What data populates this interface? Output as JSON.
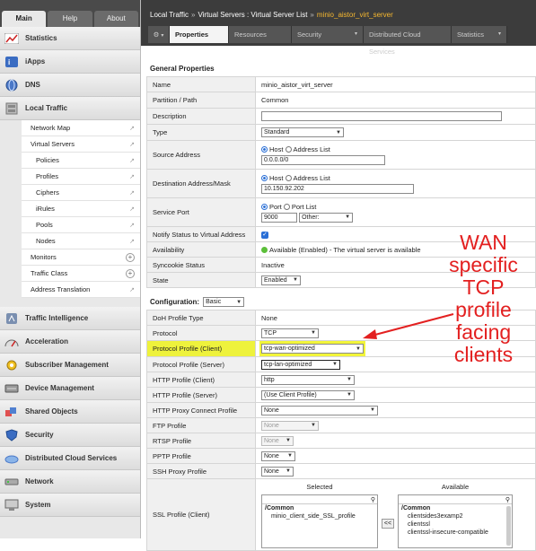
{
  "nav": {
    "tabs": [
      "Main",
      "Help",
      "About"
    ],
    "sections": [
      {
        "label": "Statistics",
        "icon": "statistics-icon"
      },
      {
        "label": "iApps",
        "icon": "iapps-icon"
      },
      {
        "label": "DNS",
        "icon": "dns-icon"
      },
      {
        "label": "Local Traffic",
        "icon": "local-traffic-icon"
      }
    ],
    "local_traffic_items": [
      {
        "label": "Network Map",
        "indent": false,
        "suffix": "arrow"
      },
      {
        "label": "Virtual Servers",
        "indent": false,
        "suffix": "arrow"
      },
      {
        "label": "Policies",
        "indent": true,
        "suffix": "arrow"
      },
      {
        "label": "Profiles",
        "indent": true,
        "suffix": "arrow"
      },
      {
        "label": "Ciphers",
        "indent": true,
        "suffix": "arrow"
      },
      {
        "label": "iRules",
        "indent": true,
        "suffix": "arrow"
      },
      {
        "label": "Pools",
        "indent": true,
        "suffix": "arrow"
      },
      {
        "label": "Nodes",
        "indent": true,
        "suffix": "arrow"
      },
      {
        "label": "Monitors",
        "indent": false,
        "suffix": "plus"
      },
      {
        "label": "Traffic Class",
        "indent": false,
        "suffix": "plus"
      },
      {
        "label": "Address Translation",
        "indent": false,
        "suffix": "arrow"
      }
    ],
    "lower_sections": [
      {
        "label": "Traffic Intelligence",
        "icon": "traffic-intelligence-icon"
      },
      {
        "label": "Acceleration",
        "icon": "acceleration-icon"
      },
      {
        "label": "Subscriber Management",
        "icon": "subscriber-management-icon"
      },
      {
        "label": "Device Management",
        "icon": "device-management-icon"
      },
      {
        "label": "Shared Objects",
        "icon": "shared-objects-icon"
      },
      {
        "label": "Security",
        "icon": "security-icon"
      },
      {
        "label": "Distributed Cloud Services",
        "icon": "distributed-cloud-icon"
      },
      {
        "label": "Network",
        "icon": "network-icon"
      },
      {
        "label": "System",
        "icon": "system-icon"
      }
    ]
  },
  "header": {
    "breadcrumb": [
      "Local Traffic",
      "Virtual Servers : Virtual Server List",
      "minio_aistor_virt_server"
    ],
    "separators": [
      "»",
      "»"
    ],
    "tabs": [
      "Properties",
      "Resources",
      "Security",
      "Distributed Cloud Services",
      "Statistics"
    ]
  },
  "general": {
    "title": "General Properties",
    "name_label": "Name",
    "name_value": "minio_aistor_virt_server",
    "partition_label": "Partition / Path",
    "partition_value": "Common",
    "description_label": "Description",
    "type_label": "Type",
    "type_value": "Standard",
    "source_label": "Source Address",
    "source_radio1": "Host",
    "source_radio2": "Address List",
    "source_value": "0.0.0.0/0",
    "dest_label": "Destination Address/Mask",
    "dest_radio1": "Host",
    "dest_radio2": "Address List",
    "dest_value": "10.150.92.202",
    "port_label": "Service Port",
    "port_radio1": "Port",
    "port_radio2": "Port List",
    "port_value": "9000",
    "port_select": "Other:",
    "notify_label": "Notify Status to Virtual Address",
    "availability_label": "Availability",
    "availability_value": "Available (Enabled) - The virtual server is available",
    "syncookie_label": "Syncookie Status",
    "syncookie_value": "Inactive",
    "state_label": "State",
    "state_value": "Enabled"
  },
  "config": {
    "title": "Configuration:",
    "mode": "Basic",
    "doh_label": "DoH Profile Type",
    "doh_value": "None",
    "protocol_label": "Protocol",
    "protocol_value": "TCP",
    "pclient_label": "Protocol Profile (Client)",
    "pclient_value": "tcp-wan-optimized",
    "pserver_label": "Protocol Profile (Server)",
    "pserver_value": "tcp-lan-optimized",
    "httpc_label": "HTTP Profile (Client)",
    "httpc_value": "http",
    "https_label": "HTTP Profile (Server)",
    "https_value": "(Use Client Profile)",
    "proxy_label": "HTTP Proxy Connect Profile",
    "proxy_value": "None",
    "ftp_label": "FTP Profile",
    "ftp_value": "None",
    "rtsp_label": "RTSP Profile",
    "rtsp_value": "None",
    "pptp_label": "PPTP Profile",
    "pptp_value": "None",
    "ssh_label": "SSH Proxy Profile",
    "ssh_value": "None",
    "ssl_label": "SSL Profile (Client)",
    "selected_header": "Selected",
    "available_header": "Available",
    "selected_group": "/Common",
    "selected_item": "minio_client_side_SSL_profile",
    "available_group": "/Common",
    "available_items": [
      "clientsides3examp2",
      "clientssl",
      "clientssl-insecure-compatible"
    ],
    "move_left": "<<"
  },
  "annotation": {
    "text_lines": [
      "WAN",
      "specific",
      "TCP",
      "profile",
      "facing",
      "clients"
    ],
    "color": "#e32020"
  }
}
